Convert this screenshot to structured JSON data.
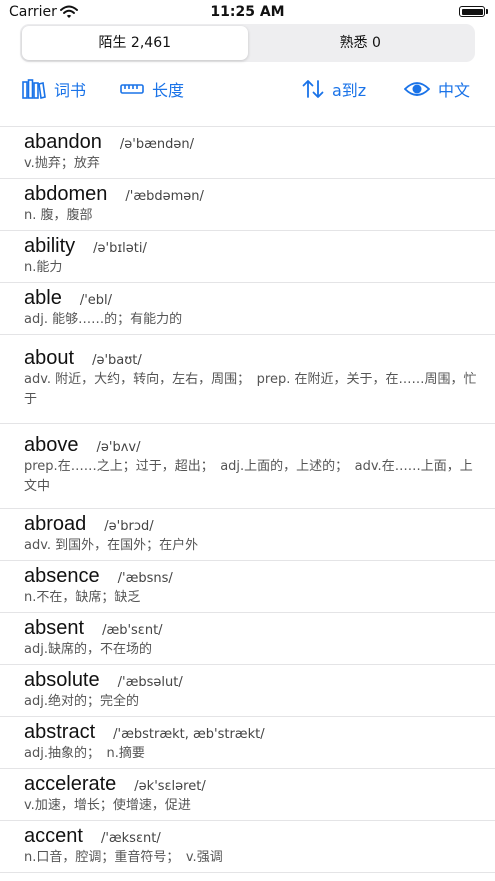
{
  "status": {
    "carrier": "Carrier",
    "time": "11:25 AM"
  },
  "segment": [
    {
      "label": "陌生 2,461",
      "active": true
    },
    {
      "label": "熟悉 0",
      "active": false
    }
  ],
  "toolbar": {
    "book_label": "词书",
    "length_label": "长度",
    "sort_label": "a到z",
    "lang_label": "中文",
    "accent_color": "#1a73e8"
  },
  "words": [
    {
      "word": "abandon",
      "pron": "/ə'bændən/",
      "def": "v.抛弃；放弃"
    },
    {
      "word": "abdomen",
      "pron": "/'æbdəmən/",
      "def": "n. 腹，腹部"
    },
    {
      "word": "ability",
      "pron": "/ə'bɪləti/",
      "def": "n.能力"
    },
    {
      "word": "able",
      "pron": "/'ebl/",
      "def": "adj. 能够……的；有能力的"
    },
    {
      "word": "about",
      "pron": "/ə'baʊt/",
      "def": "adv. 附近，大约，转向，左右，周围；　prep. 在附近，关于，在……周围，忙于"
    },
    {
      "word": "above",
      "pron": "/ə'bʌv/",
      "def": "prep.在……之上；过于，超出；　adj.上面的，上述的；　adv.在……上面，上文中"
    },
    {
      "word": "abroad",
      "pron": "/ə'brɔd/",
      "def": "adv. 到国外，在国外；在户外"
    },
    {
      "word": "absence",
      "pron": "/'æbsns/",
      "def": "n.不在，缺席；缺乏"
    },
    {
      "word": "absent",
      "pron": "/æb'sɛnt/",
      "def": "adj.缺席的，不在场的"
    },
    {
      "word": "absolute",
      "pron": "/'æbsəlut/",
      "def": "adj.绝对的；完全的"
    },
    {
      "word": "abstract",
      "pron": "/'æbstrækt, æb'strækt/",
      "def": "adj.抽象的；　n.摘要"
    },
    {
      "word": "accelerate",
      "pron": "/ək'sɛləret/",
      "def": "v.加速，增长；使增速，促进"
    },
    {
      "word": "accent",
      "pron": "/'æksɛnt/",
      "def": "n.口音，腔调；重音符号；　v.强调"
    }
  ]
}
